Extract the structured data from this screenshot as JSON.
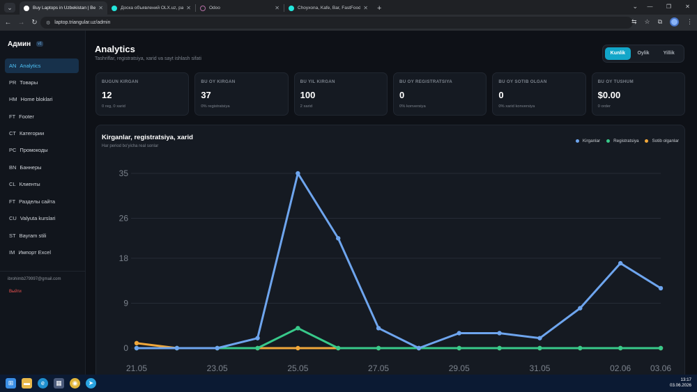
{
  "browser": {
    "tabs": [
      {
        "title": "Buy Laptops in Uzbekistan | Be",
        "favicon_color": "#ffffff",
        "active": true
      },
      {
        "title": "Доска объявлений OLX.uz, ра",
        "favicon_color": "#23e5db",
        "active": false
      },
      {
        "title": "Odoo",
        "favicon_color": "#b46fa5",
        "active": false
      },
      {
        "title": "Choyxona, Kafe, Bar, FastFood",
        "favicon_color": "#23e5db",
        "active": false
      }
    ],
    "url": "laptop.triangular.uz/admin"
  },
  "sidebar": {
    "title": "Админ",
    "badge": "v1",
    "items": [
      {
        "code": "AN",
        "label": "Analytics",
        "active": true
      },
      {
        "code": "PR",
        "label": "Товары",
        "active": false
      },
      {
        "code": "HM",
        "label": "Home bloklari",
        "active": false
      },
      {
        "code": "FT",
        "label": "Footer",
        "active": false
      },
      {
        "code": "CT",
        "label": "Категории",
        "active": false
      },
      {
        "code": "PC",
        "label": "Промокоды",
        "active": false
      },
      {
        "code": "BN",
        "label": "Баннеры",
        "active": false
      },
      {
        "code": "CL",
        "label": "Клиенты",
        "active": false
      },
      {
        "code": "FT",
        "label": "Разделы сайта",
        "active": false
      },
      {
        "code": "CU",
        "label": "Valyuta kurslari",
        "active": false
      },
      {
        "code": "ST",
        "label": "Bayram stili",
        "active": false
      },
      {
        "code": "IM",
        "label": "Импорт Excel",
        "active": false
      }
    ],
    "email": "ibrohimb279997@gmail.com",
    "logout": "Выйти"
  },
  "header": {
    "title": "Analytics",
    "subtitle": "Tashriflar, registratsiya, xarid va sayt ishlash sifati",
    "periods": [
      {
        "label": "Kunlik",
        "active": true
      },
      {
        "label": "Oylik",
        "active": false
      },
      {
        "label": "Yillik",
        "active": false
      }
    ]
  },
  "stats": [
    {
      "label": "BUGUN KIRGAN",
      "value": "12",
      "note": "0 reg, 0 xarid"
    },
    {
      "label": "BU OY KIRGAN",
      "value": "37",
      "note": "0% registratsiya"
    },
    {
      "label": "BU YIL KIRGAN",
      "value": "100",
      "note": "2 xarid"
    },
    {
      "label": "BU OY REGISTRATSIYA",
      "value": "0",
      "note": "0% konversiya"
    },
    {
      "label": "BU OY SOTIB OLGAN",
      "value": "0",
      "note": "0% xarid konversiya"
    },
    {
      "label": "BU OY TUSHUM",
      "value": "$0.00",
      "note": "0 order"
    }
  ],
  "chart": {
    "title": "Kirganlar, registratsiya, xarid",
    "subtitle": "Har period bo'yicha real sonlar"
  },
  "chart_data": {
    "type": "line",
    "x": [
      "21.05",
      "22.05",
      "23.05",
      "24.05",
      "25.05",
      "26.05",
      "27.05",
      "28.05",
      "29.05",
      "30.05",
      "31.05",
      "01.06",
      "02.06",
      "03.06"
    ],
    "x_tick_labels": [
      "21.05",
      "23.05",
      "25.05",
      "27.05",
      "29.05",
      "31.05",
      "02.06",
      "03.06"
    ],
    "y_ticks": [
      0,
      9,
      18,
      26,
      35
    ],
    "ylim": [
      0,
      35
    ],
    "grid": true,
    "legend_position": "top-right",
    "series": [
      {
        "name": "Kirganlar",
        "color": "#6ea5ee",
        "values": [
          0,
          0,
          0,
          2,
          35,
          22,
          4,
          0,
          3,
          3,
          2,
          8,
          17,
          12
        ]
      },
      {
        "name": "Registratsiya",
        "color": "#38c98a",
        "values": [
          0,
          0,
          0,
          0,
          4,
          0,
          0,
          0,
          0,
          0,
          0,
          0,
          0,
          0
        ]
      },
      {
        "name": "Sotib olganlar",
        "color": "#f0a73a",
        "values": [
          1,
          0,
          0,
          0,
          0,
          0,
          0,
          0,
          0,
          0,
          0,
          0,
          0,
          0
        ]
      }
    ]
  },
  "taskbar": {
    "time": "13:17",
    "date": "03.06.2026"
  }
}
